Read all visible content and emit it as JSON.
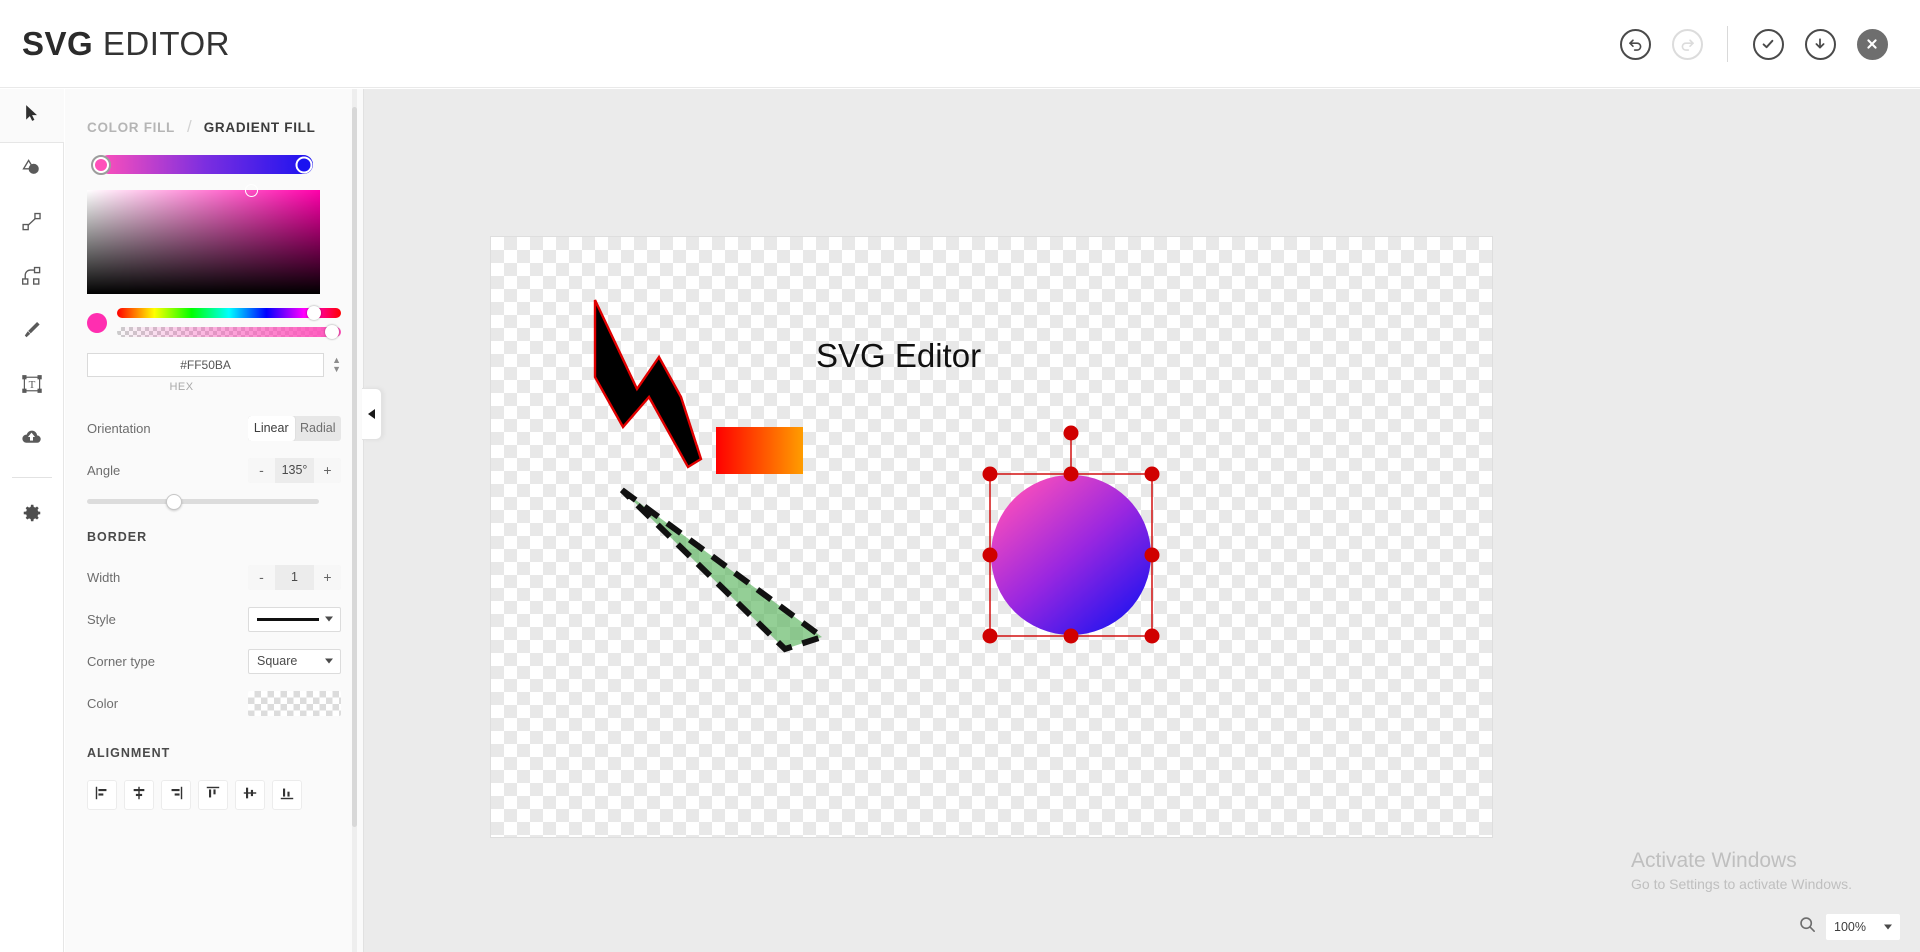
{
  "app": {
    "title_bold": "SVG",
    "title_light": " EDITOR"
  },
  "header_actions": [
    {
      "name": "undo-button",
      "icon": "undo-icon",
      "state": "enabled"
    },
    {
      "name": "redo-button",
      "icon": "redo-icon",
      "state": "disabled"
    },
    {
      "name": "confirm-button",
      "icon": "check-icon",
      "state": "enabled"
    },
    {
      "name": "download-button",
      "icon": "download-icon",
      "state": "enabled"
    },
    {
      "name": "close-button",
      "icon": "close-icon",
      "state": "filled"
    }
  ],
  "toolbar": {
    "tools": [
      {
        "name": "select-tool",
        "icon": "cursor-arrow-icon",
        "active": true
      },
      {
        "name": "shape-tool",
        "icon": "shapes-icon",
        "active": false
      },
      {
        "name": "line-tool",
        "icon": "line-icon",
        "active": false
      },
      {
        "name": "path-tool",
        "icon": "bezier-path-icon",
        "active": false
      },
      {
        "name": "brush-tool",
        "icon": "brush-icon",
        "active": false
      },
      {
        "name": "text-tool",
        "icon": "text-box-icon",
        "active": false
      },
      {
        "name": "upload-tool",
        "icon": "cloud-upload-icon",
        "active": false
      },
      {
        "name": "settings-tool",
        "icon": "gear-icon",
        "active": false
      }
    ]
  },
  "panel": {
    "tabs": {
      "color_fill": "COLOR FILL",
      "separator": "/",
      "gradient_fill": "GRADIENT FILL",
      "active": "GRADIENT FILL"
    },
    "gradient": {
      "start_color": "#FF50BA",
      "mid_color": "#7B2EE0",
      "end_color": "#1A12F0",
      "selected_stop": "start"
    },
    "picker": {
      "hue_value": "#FF00AA",
      "preview_color": "#FF2EB0",
      "hue_knob_pct": 88,
      "alpha_knob_pct": 96
    },
    "hex": {
      "value": "#FF50BA",
      "label": "HEX"
    },
    "orientation": {
      "label": "Orientation",
      "options": [
        "Linear",
        "Radial"
      ],
      "selected": "Linear"
    },
    "angle": {
      "label": "Angle",
      "minus": "-",
      "value": "135°",
      "plus": "+",
      "slider_pct": 37.5
    },
    "border": {
      "title": "BORDER",
      "width": {
        "label": "Width",
        "minus": "-",
        "value": "1",
        "plus": "+"
      },
      "style": {
        "label": "Style",
        "value": "solid-line"
      },
      "corner": {
        "label": "Corner type",
        "value": "Square"
      },
      "color": {
        "label": "Color",
        "value": "transparent"
      }
    },
    "alignment": {
      "title": "ALIGNMENT",
      "buttons": [
        {
          "name": "align-left-button",
          "icon": "align-left-icon"
        },
        {
          "name": "align-center-button",
          "icon": "align-center-horizontal-icon"
        },
        {
          "name": "align-right-button",
          "icon": "align-right-icon"
        },
        {
          "name": "align-top-button",
          "icon": "align-top-icon"
        },
        {
          "name": "align-middle-button",
          "icon": "align-middle-vertical-icon"
        },
        {
          "name": "align-bottom-button",
          "icon": "align-bottom-icon"
        }
      ]
    }
  },
  "canvas": {
    "text_object": "SVG Editor",
    "shapes": [
      {
        "name": "zigzag-arrow",
        "fill": "#000000",
        "stroke": "#E00000",
        "stroke_width": 1
      },
      {
        "name": "gradient-rect",
        "fill_start": "#FF0000",
        "fill_end": "#FF9900"
      },
      {
        "name": "green-triangle",
        "fill": "rgba(76,175,80,0.62)",
        "stroke": "#111111",
        "stroke_dash": "16 10"
      },
      {
        "name": "selected-circle",
        "fill_start": "#FF50BA",
        "fill_end": "#1A12F0",
        "selected": true
      }
    ],
    "selection_color": "#D00000"
  },
  "watermark": {
    "title": "Activate Windows",
    "subtitle": "Go to Settings to activate Windows."
  },
  "zoom": {
    "icon": "magnifier-icon",
    "value": "100%"
  }
}
